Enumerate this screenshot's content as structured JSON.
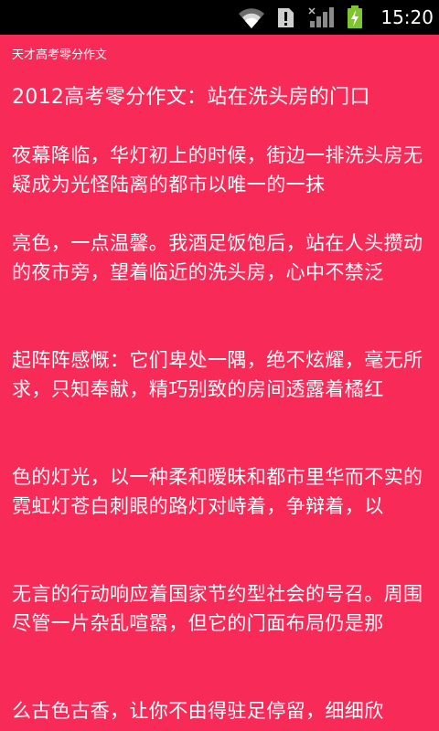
{
  "status_bar": {
    "time": "15:20",
    "icons": [
      "wifi-icon",
      "sim-alert-icon",
      "signal-icon",
      "battery-charging-icon"
    ]
  },
  "app": {
    "title": "天才高考零分作文"
  },
  "article": {
    "title": "2012高考零分作文：站在洗头房的门口",
    "paragraphs": [
      "夜幕降临，华灯初上的时候，街边一排洗头房无疑成为光怪陆离的都市以唯一的一抹",
      "亮色，一点温馨。我酒足饭饱后，站在人头攒动的夜市旁，望着临近的洗头房，心中不禁泛",
      "起阵阵感慨：它们卑处一隅，绝不炫耀，毫无所求，只知奉献，精巧别致的房间透露着橘红",
      "色的灯光，以一种柔和暧昧和都市里华而不实的霓虹灯苍白刺眼的路灯对峙着，争辩着，以",
      "无言的行动响应着国家节约型社会的号召。周围尽管一片杂乱喧嚣，但它的门面布局仍是那",
      "么古色古香，让你不由得驻足停留，细细欣"
    ]
  },
  "colors": {
    "background": "#f72a58",
    "status_bar": "#000000",
    "text": "#ffffff"
  }
}
